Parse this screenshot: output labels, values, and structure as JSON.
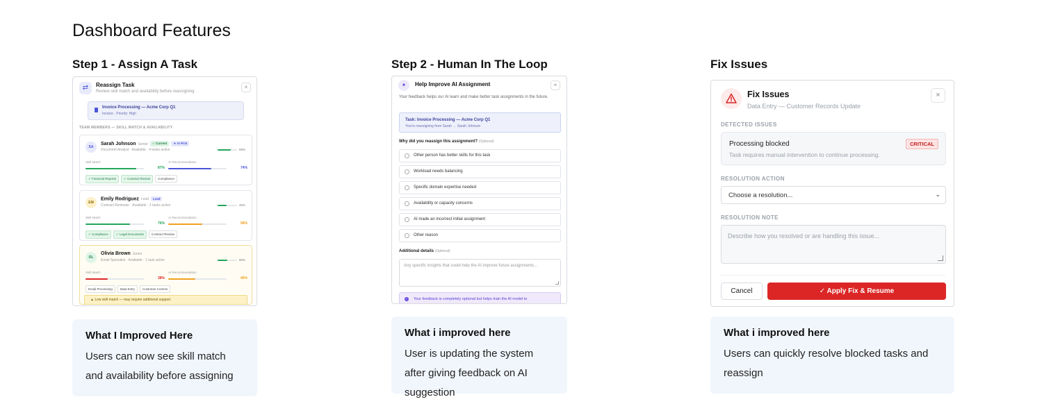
{
  "page": {
    "title": "Dashboard Features"
  },
  "steps": [
    {
      "title": "Step 1 - Assign A Task",
      "note": {
        "heading": "What I Improved Here",
        "text": "Users can now see skill match and availability before assigning"
      }
    },
    {
      "title": "Step 2 - Human In The Loop",
      "note": {
        "heading": "What i improved here",
        "text": "User is updating the system after giving feedback on AI suggestion"
      }
    },
    {
      "title": "Fix Issues",
      "note": {
        "heading": "What i improved here",
        "text": "Users can quickly resolve blocked tasks and reassign"
      }
    }
  ],
  "reassign": {
    "title": "Reassign Task",
    "subtitle": "Review skill match and availability before reassigning",
    "close": "×",
    "task_title": "Invoice Processing — Acme Corp Q1",
    "task_sub": "Invoice · Priority: High",
    "section": "TEAM MEMBERS — SKILL MATCH & AVAILABILITY",
    "skill_label": "Skill Match",
    "ai_label": "AI Recommendation",
    "members": [
      {
        "initials": "SA",
        "name": "Sarah Johnson",
        "level": "Senior",
        "badges": [
          {
            "text": "✓ Current",
            "bg": "#dcf3e4",
            "fg": "#1f7d43"
          },
          {
            "text": "★ AI Pick",
            "bg": "#e6e8fb",
            "fg": "#4a55d6"
          }
        ],
        "role": "Document Analyst · Available · 4 tasks active",
        "availability_pct": "69%",
        "availability": 0.69,
        "skill_pct": "87%",
        "skill": 0.87,
        "skill_color": "#22a55a",
        "ai_pct": "74%",
        "ai": 0.74,
        "ai_color": "#4a55d6",
        "tags": [
          {
            "text": "✓ Financial Reports",
            "good": true
          },
          {
            "text": "✓ Contract Review",
            "good": true
          },
          {
            "text": "Compliance",
            "good": false
          }
        ],
        "avatar_bg": "#e6e8fb",
        "avatar_fg": "#4a55d6"
      },
      {
        "initials": "EM",
        "name": "Emily Rodriguez",
        "level": "Lead",
        "badges": [
          {
            "text": "Lead",
            "bg": "#e6e8fb",
            "fg": "#4a55d6"
          }
        ],
        "role": "Contract Reviewer · Available · 2 tasks active",
        "availability_pct": "45%",
        "availability": 0.45,
        "skill_pct": "76%",
        "skill": 0.76,
        "skill_color": "#22a55a",
        "ai_pct": "58%",
        "ai": 0.58,
        "ai_color": "#f0a020",
        "tags": [
          {
            "text": "✓ Compliance",
            "good": true
          },
          {
            "text": "✓ Legal Documents",
            "good": true
          },
          {
            "text": "Contract Review",
            "good": false
          }
        ],
        "avatar_bg": "#fdf0c9",
        "avatar_fg": "#8a6a00"
      },
      {
        "initials": "OL",
        "name": "Olivia Brown",
        "level": "Junior",
        "badges": [],
        "role": "Email Specialist · Available · 1 task active",
        "availability_pct": "50%",
        "availability": 0.5,
        "skill_pct": "38%",
        "skill": 0.38,
        "skill_color": "#dc2626",
        "ai_pct": "46%",
        "ai": 0.46,
        "ai_color": "#f0a020",
        "tags": [
          {
            "text": "Email Processing",
            "good": false
          },
          {
            "text": "Data Entry",
            "good": false
          },
          {
            "text": "Customer Comms",
            "good": false
          }
        ],
        "avatar_bg": "#dff5e8",
        "avatar_fg": "#1f7d43"
      }
    ],
    "warning": "▲ Low skill match — may require additional support"
  },
  "feedback": {
    "title": "Help Improve AI Assignment",
    "close": "×",
    "intro": "Your feedback helps our AI learn and make better task assignments in the future.",
    "task_title": "Task: Invoice Processing — Acme Corp Q1",
    "task_sub": "You're reassigning from Sarah → Sarah Johnson",
    "question": "Why did you reassign this assignment?",
    "optional": "(Optional)",
    "options": [
      "Other person has better skills for this task",
      "Workload needs balancing",
      "Specific domain expertise needed",
      "Availability or capacity concerns",
      "AI made an incorrect initial assignment",
      "Other reason"
    ],
    "additional_label": "Additional details",
    "additional_placeholder": "Any specific insights that could help the AI improve future assignments...",
    "info": "Your feedback is completely optional but helps train the AI model to"
  },
  "fix": {
    "title": "Fix Issues",
    "subtitle": "Data Entry — Customer Records Update",
    "close": "×",
    "detected_label": "DETECTED ISSUES",
    "issue_title": "Processing blocked",
    "issue_badge": "CRITICAL",
    "issue_sub": "Task requires manual intervention to continue processing.",
    "resolution_label": "RESOLUTION ACTION",
    "resolution_value": "Choose a resolution...",
    "note_label": "RESOLUTION NOTE",
    "note_placeholder": "Describe how you resolved or are handling this issue...",
    "cancel": "Cancel",
    "apply": "✓  Apply Fix & Resume",
    "accent": "#dc2626"
  }
}
